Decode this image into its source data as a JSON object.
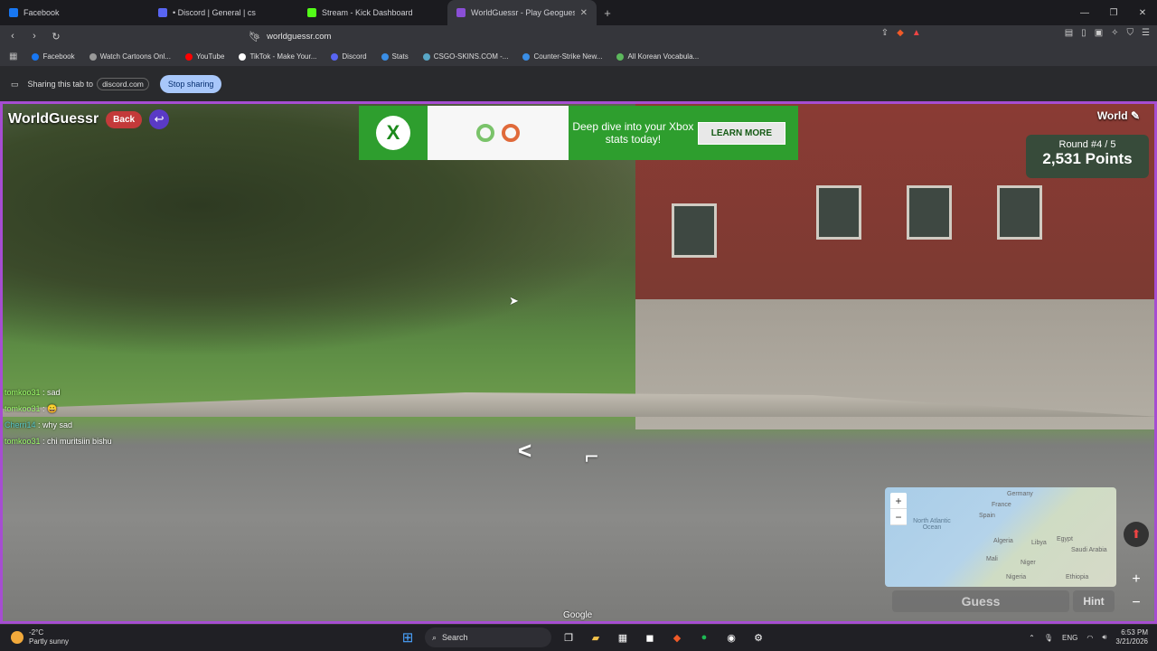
{
  "tabs": [
    {
      "label": "Facebook",
      "color": "#1877f2"
    },
    {
      "label": "• Discord | General | cs",
      "color": "#5865f2"
    },
    {
      "label": "Stream - Kick Dashboard",
      "color": "#53fc18"
    },
    {
      "label": "WorldGuessr - Play Geoguessr",
      "color": "#8a4fd6",
      "active": true
    }
  ],
  "address": {
    "url": "worldguessr.com"
  },
  "bookmarks": [
    {
      "label": "Facebook",
      "color": "#1877f2"
    },
    {
      "label": "Watch Cartoons Onl...",
      "color": "#999999"
    },
    {
      "label": "YouTube",
      "color": "#ff0000"
    },
    {
      "label": "TikTok - Make Your...",
      "color": "#ffffff"
    },
    {
      "label": "Discord",
      "color": "#5865f2"
    },
    {
      "label": "Stats",
      "color": "#3a8ee6"
    },
    {
      "label": "CSGO-SKINS.COM -...",
      "color": "#58a6c6"
    },
    {
      "label": "Counter-Strike New...",
      "color": "#3a8ee6"
    },
    {
      "label": "All Korean Vocabula...",
      "color": "#5cb85c"
    }
  ],
  "sharebar": {
    "text": "Sharing this tab to",
    "target": "discord.com",
    "stop": "Stop sharing"
  },
  "game": {
    "logo": "WorldGuessr",
    "back": "Back",
    "mode": "World",
    "round": "Round #4 / 5",
    "points": "2,531 Points",
    "guess": "Guess",
    "hint": "Hint",
    "attribution": "Google"
  },
  "ad": {
    "text": "Deep dive into your Xbox stats today!",
    "cta": "LEARN MORE"
  },
  "chat": [
    {
      "user": "tomkoo31",
      "msg": ": sad"
    },
    {
      "user": "tomkoo31",
      "msg": ": 😀"
    },
    {
      "user": "Cherri14",
      "msg": ": why sad"
    },
    {
      "user": "tomkoo31",
      "msg": ": chi muritsiin bishu"
    }
  ],
  "map": {
    "labels": [
      "Germany",
      "France",
      "Spain",
      "North Atlantic Ocean",
      "Algeria",
      "Libya",
      "Egypt",
      "Mali",
      "Niger",
      "Nigeria",
      "Saudi Arabia",
      "Ethiopia"
    ]
  },
  "taskbar": {
    "temp": "-2°C",
    "weather": "Partly sunny",
    "search": "Search",
    "lang": "ENG",
    "time": "6:53 PM",
    "date": "3/21/2026"
  }
}
